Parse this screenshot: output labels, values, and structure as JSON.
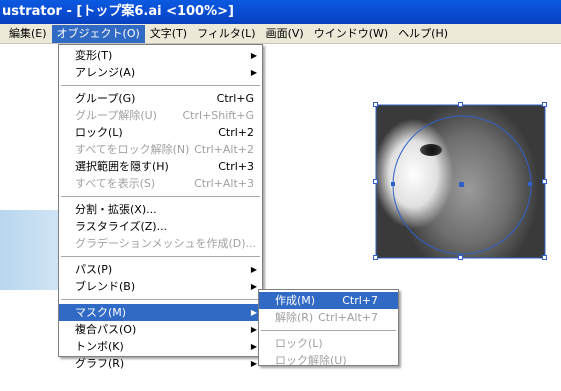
{
  "window": {
    "title": "ustrator - [トップ案6.ai <100%>]"
  },
  "menubar": {
    "items": [
      {
        "label": "編集(E)"
      },
      {
        "label": "オブジェクト(O)"
      },
      {
        "label": "文字(T)"
      },
      {
        "label": "フィルタ(L)"
      },
      {
        "label": "画面(V)"
      },
      {
        "label": "ウインドウ(W)"
      },
      {
        "label": "ヘルプ(H)"
      }
    ]
  },
  "object_menu": {
    "groups": [
      [
        {
          "label": "変形(T)",
          "submenu": true
        },
        {
          "label": "アレンジ(A)",
          "submenu": true
        }
      ],
      [
        {
          "label": "グループ(G)",
          "shortcut": "Ctrl+G"
        },
        {
          "label": "グループ解除(U)",
          "shortcut": "Ctrl+Shift+G",
          "disabled": true
        },
        {
          "label": "ロック(L)",
          "shortcut": "Ctrl+2"
        },
        {
          "label": "すべてをロック解除(N)",
          "shortcut": "Ctrl+Alt+2",
          "disabled": true
        },
        {
          "label": "選択範囲を隠す(H)",
          "shortcut": "Ctrl+3"
        },
        {
          "label": "すべてを表示(S)",
          "shortcut": "Ctrl+Alt+3",
          "disabled": true
        }
      ],
      [
        {
          "label": "分割・拡張(X)..."
        },
        {
          "label": "ラスタライズ(Z)..."
        },
        {
          "label": "グラデーションメッシュを作成(D)...",
          "disabled": true
        }
      ],
      [
        {
          "label": "パス(P)",
          "submenu": true
        },
        {
          "label": "ブレンド(B)",
          "submenu": true
        }
      ],
      [
        {
          "label": "マスク(M)",
          "submenu": true,
          "highlighted": true
        },
        {
          "label": "複合パス(O)",
          "submenu": true
        },
        {
          "label": "トンボ(K)",
          "submenu": true
        },
        {
          "label": "グラフ(R)",
          "submenu": true
        }
      ]
    ]
  },
  "mask_submenu": {
    "groups": [
      [
        {
          "label": "作成(M)",
          "shortcut": "Ctrl+7",
          "highlighted": true
        },
        {
          "label": "解除(R)",
          "shortcut": "Ctrl+Alt+7",
          "disabled": true
        }
      ],
      [
        {
          "label": "ロック(L)",
          "disabled": true
        },
        {
          "label": "ロック解除(U)",
          "disabled": true
        }
      ]
    ]
  },
  "colors": {
    "title_bar": "#0a4fd6",
    "menu_highlight": "#316ac5",
    "selection_stroke": "#3060c8",
    "disabled_text": "#a0a0a0"
  }
}
